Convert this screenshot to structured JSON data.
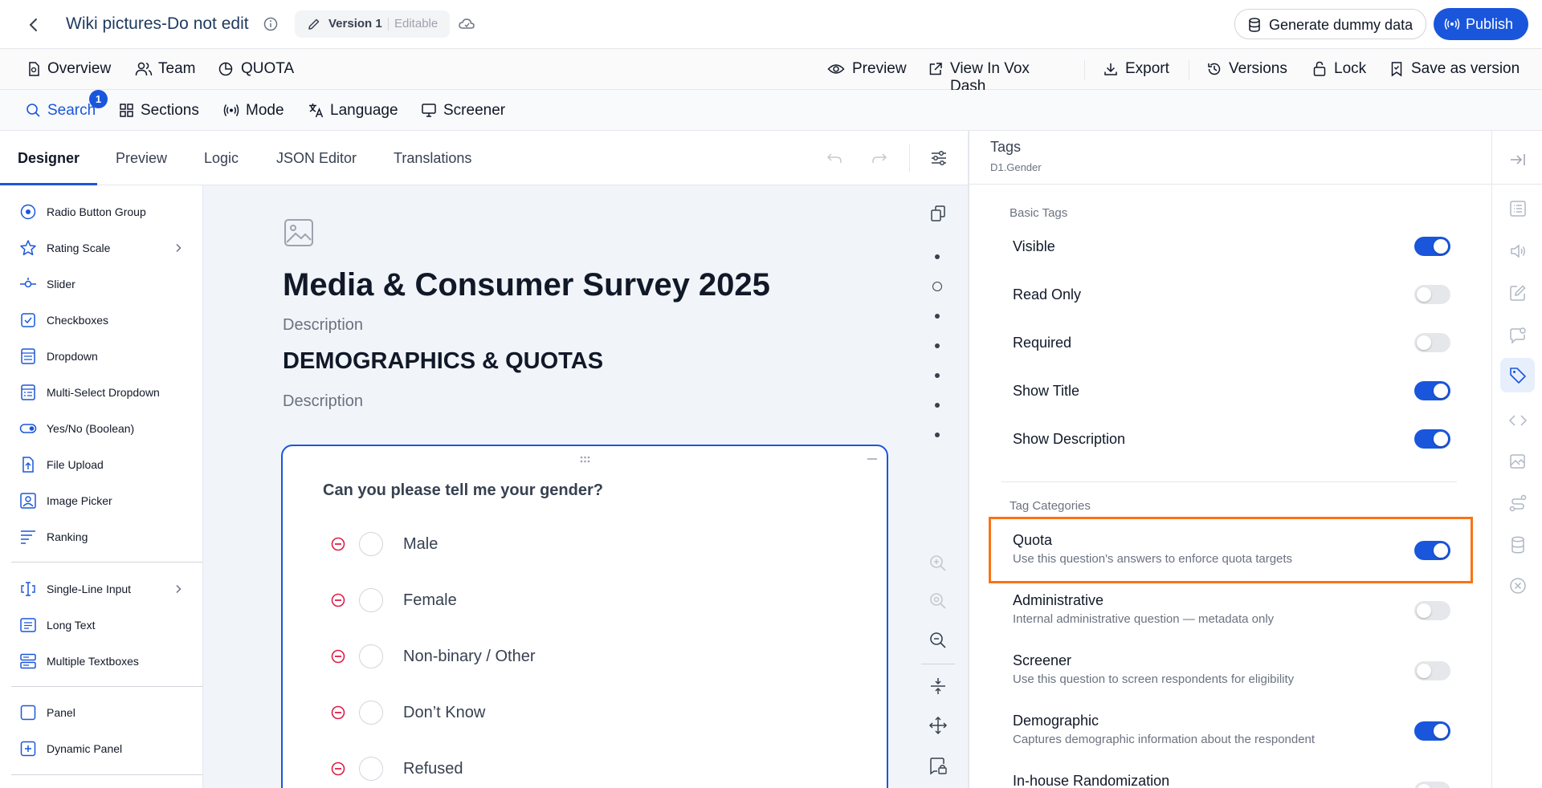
{
  "topbar": {
    "title": "Wiki pictures-Do not edit",
    "version_label": "Version 1",
    "version_state": "Editable",
    "generate_label": "Generate dummy data",
    "publish_label": "Publish"
  },
  "nav": {
    "overview": "Overview",
    "team": "Team",
    "quota": "QUOTA",
    "preview": "Preview",
    "view_in_vox_dash": "View In Vox Dash",
    "export": "Export",
    "versions": "Versions",
    "lock": "Lock",
    "save_as_version": "Save as version"
  },
  "tools": {
    "search": "Search",
    "search_badge": "1",
    "sections": "Sections",
    "mode": "Mode",
    "language": "Language",
    "screener": "Screener"
  },
  "tabs": [
    "Designer",
    "Preview",
    "Logic",
    "JSON Editor",
    "Translations"
  ],
  "palette": {
    "group1": [
      "Radio Button Group",
      "Rating Scale",
      "Slider",
      "Checkboxes",
      "Dropdown",
      "Multi-Select Dropdown",
      "Yes/No (Boolean)",
      "File Upload",
      "Image Picker",
      "Ranking"
    ],
    "group2": [
      "Single-Line Input",
      "Long Text",
      "Multiple Textboxes"
    ],
    "group3": [
      "Panel",
      "Dynamic Panel"
    ]
  },
  "survey": {
    "title": "Media & Consumer Survey 2025",
    "description": "Description",
    "section_title": "DEMOGRAPHICS & QUOTAS",
    "section_description": "Description",
    "question": "Can you please tell me your gender?",
    "choices": [
      "Male",
      "Female",
      "Non-binary / Other",
      "Don’t Know",
      "Refused"
    ]
  },
  "panel": {
    "heading": "Tags",
    "subheading": "D1.Gender",
    "basic_tags_heading": "Basic Tags",
    "basic_tags": [
      {
        "label": "Visible",
        "on": true
      },
      {
        "label": "Read Only",
        "on": false
      },
      {
        "label": "Required",
        "on": false
      },
      {
        "label": "Show Title",
        "on": true
      },
      {
        "label": "Show Description",
        "on": true
      }
    ],
    "tag_categories_heading": "Tag Categories",
    "tag_categories": [
      {
        "label": "Quota",
        "desc": "Use this question's answers to enforce quota targets",
        "on": true
      },
      {
        "label": "Administrative",
        "desc": "Internal administrative question — metadata only",
        "on": false
      },
      {
        "label": "Screener",
        "desc": "Use this question to screen respondents for eligibility",
        "on": false
      },
      {
        "label": "Demographic",
        "desc": "Captures demographic information about the respondent",
        "on": true
      },
      {
        "label": "In-house Randomization",
        "desc": "",
        "on": false
      }
    ]
  },
  "colors": {
    "accent": "#1a56db",
    "highlight": "#f97316",
    "remove": "#e11d48"
  }
}
